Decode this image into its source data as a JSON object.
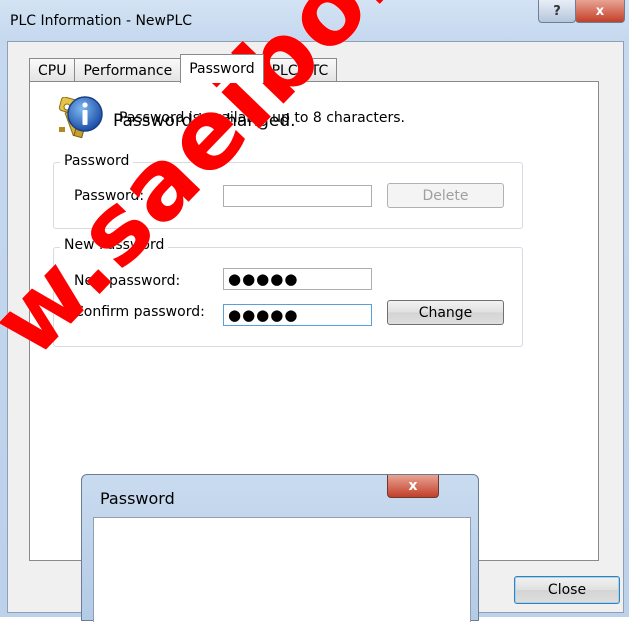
{
  "window": {
    "title": "PLC Information - NewPLC",
    "help_glyph": "?",
    "close_glyph": "x"
  },
  "tabs": [
    {
      "label": "CPU",
      "active": false
    },
    {
      "label": "Performance",
      "active": false
    },
    {
      "label": "Password",
      "active": true
    },
    {
      "label": "PLC RTC",
      "active": false
    }
  ],
  "password_tab": {
    "icon": "keys-icon",
    "info": "Password is available up to 8 characters.",
    "password_group": {
      "title": "Password",
      "field_label": "Password:",
      "field_value": "",
      "delete_button": "Delete"
    },
    "new_password_group": {
      "title": "New Password",
      "new_label": "New password:",
      "new_value": "●●●●●",
      "confirm_label": "Confirm password:",
      "confirm_value": "●●●●●",
      "change_button": "Change"
    }
  },
  "footer": {
    "close_button": "Close"
  },
  "message_box": {
    "title": "Password",
    "close_glyph": "x",
    "icon": "info-icon",
    "text": "Password is changed."
  },
  "watermark": "w.saeibonyad.co"
}
